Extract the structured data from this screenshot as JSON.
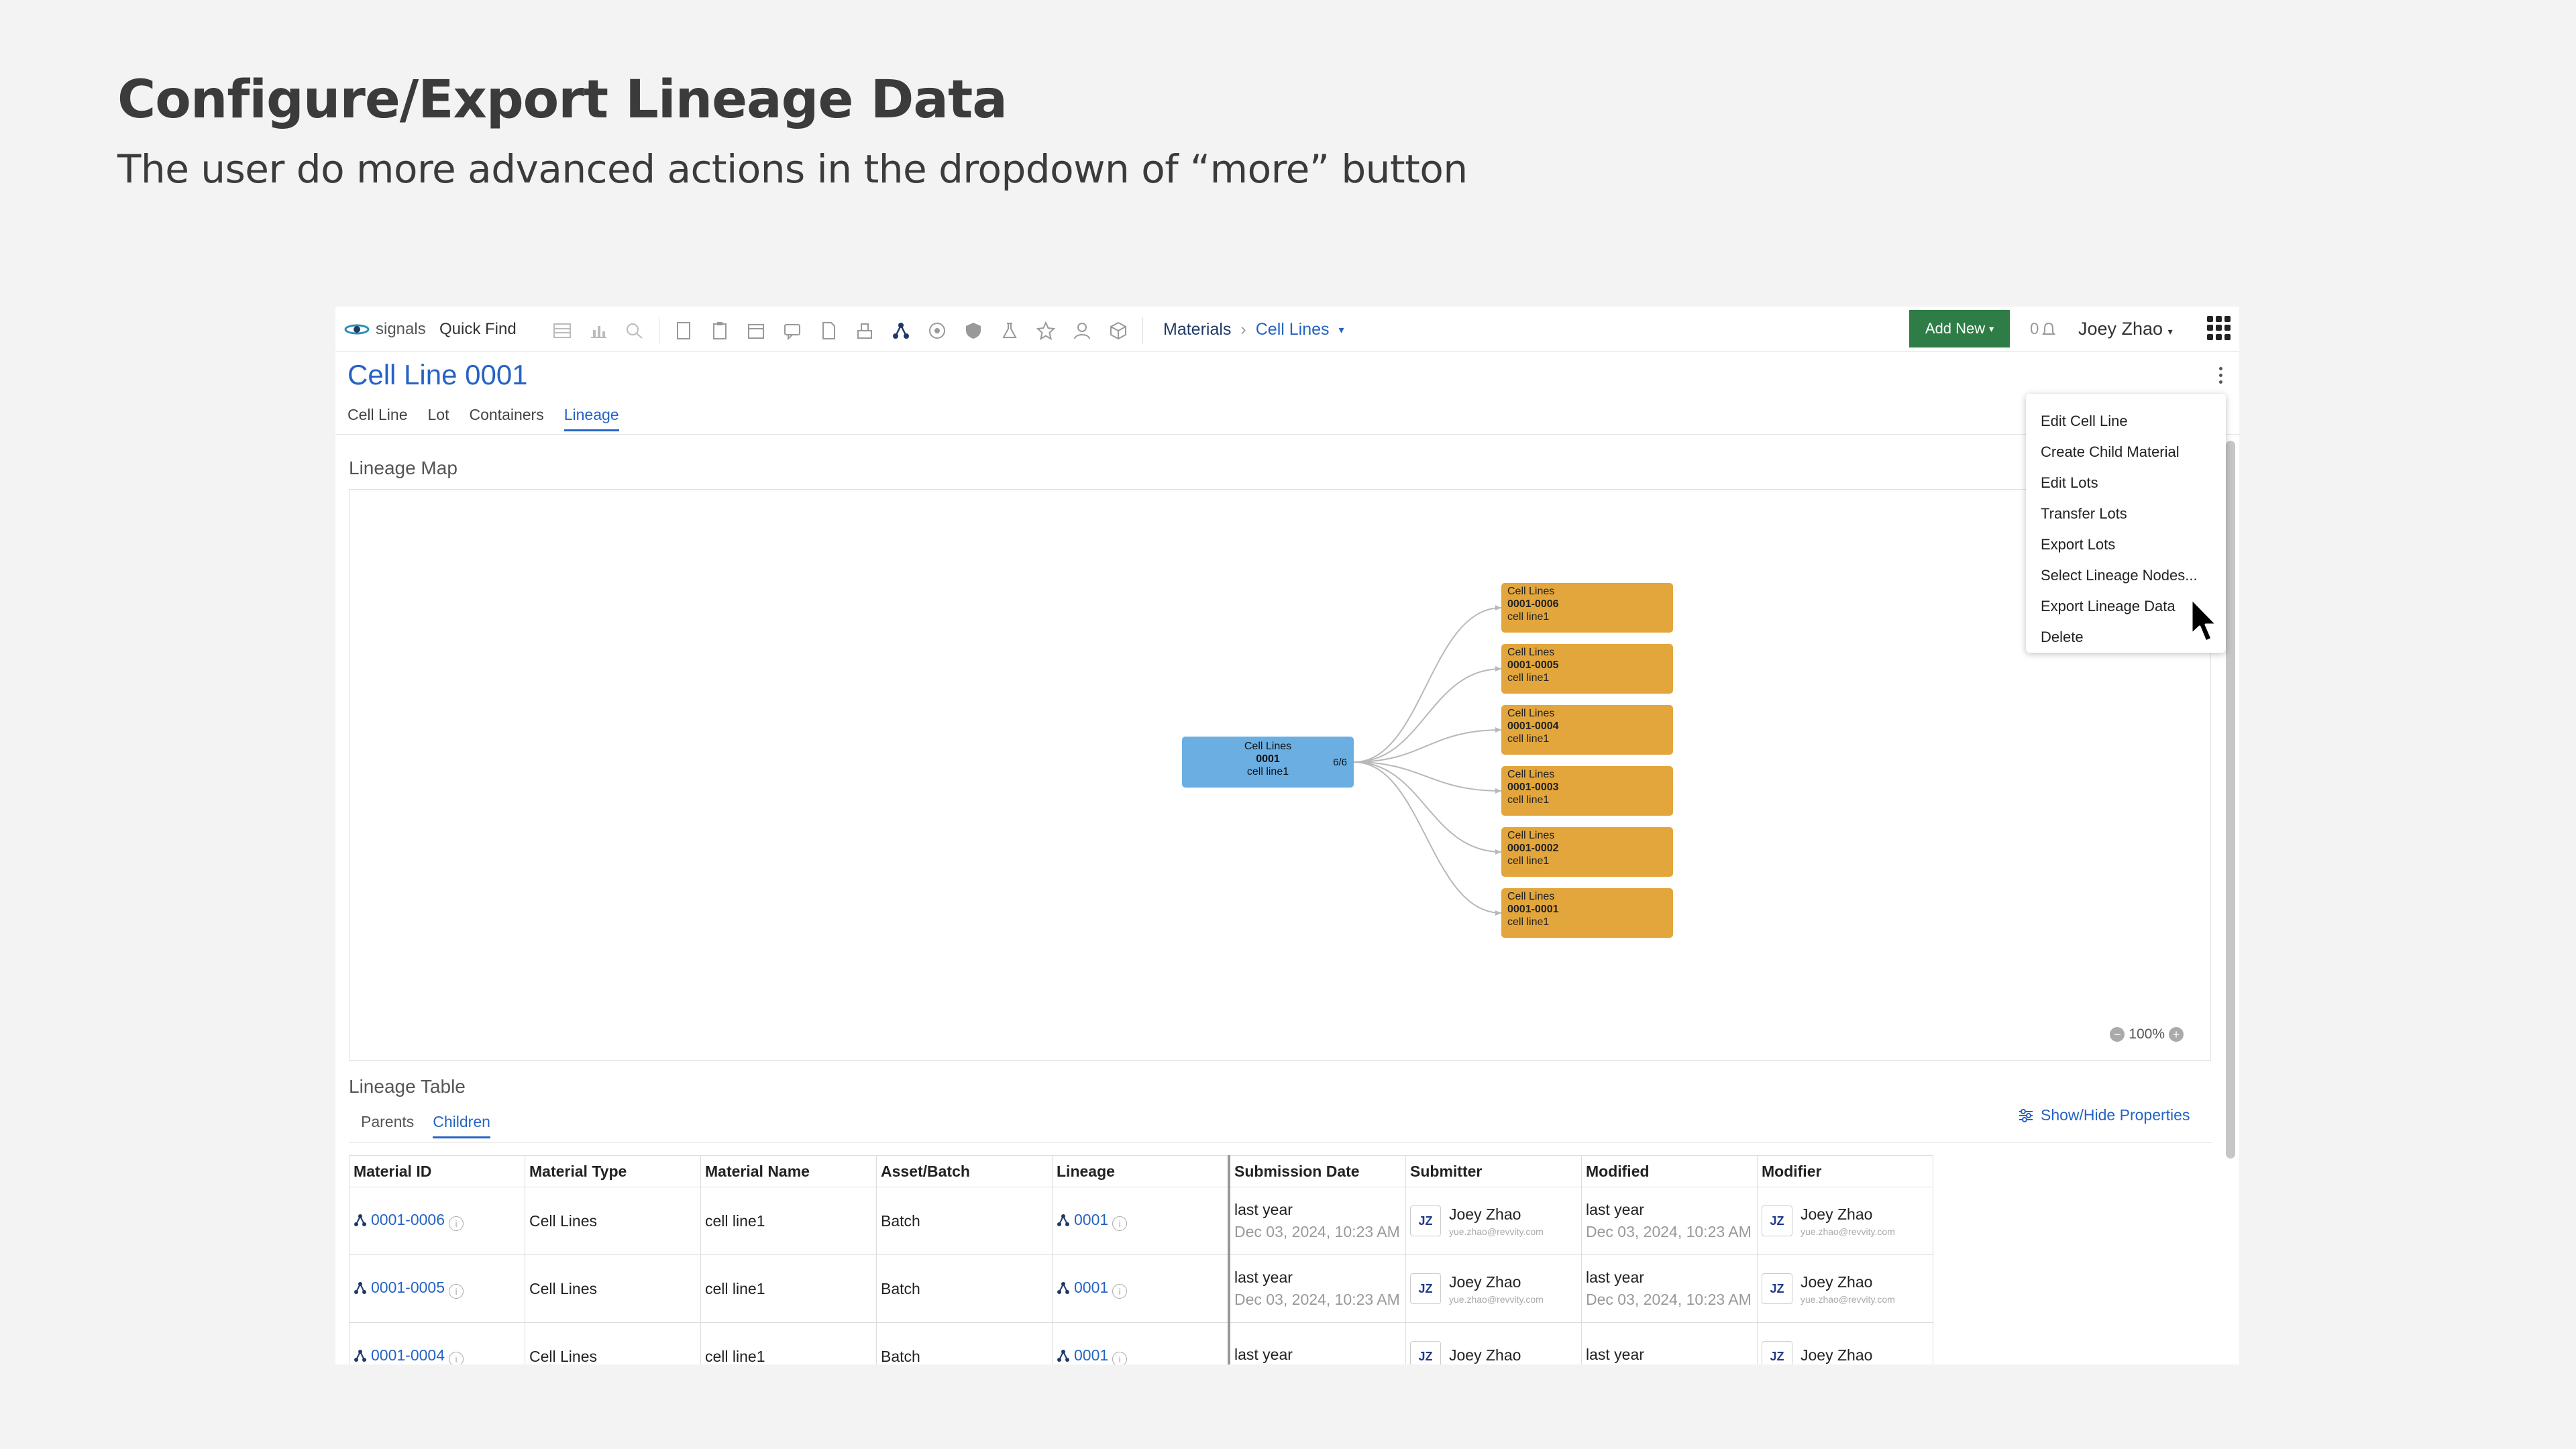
{
  "slide": {
    "title": "Configure/Export Lineage Data",
    "subtitle": "The user do more advanced actions in the dropdown of “more” button"
  },
  "topbar": {
    "logo_text": "signals",
    "quick_find": "Quick Find",
    "breadcrumb": [
      "Materials",
      "Cell Lines"
    ],
    "add_new": "Add New",
    "notification_count": "0",
    "user": "Joey Zhao"
  },
  "page": {
    "title": "Cell Line 0001",
    "tabs": [
      "Cell Line",
      "Lot",
      "Containers",
      "Lineage"
    ],
    "active_tab": "Lineage"
  },
  "more_menu": {
    "items": [
      "Edit Cell Line",
      "Create Child Material",
      "Edit Lots",
      "Transfer Lots",
      "Export Lots",
      "Select Lineage Nodes...",
      "Export Lineage Data",
      "Delete"
    ]
  },
  "lineage_map": {
    "label": "Lineage Map",
    "root": {
      "type": "Cell Lines",
      "id": "0001",
      "name": "cell line1",
      "ratio": "6/6"
    },
    "children": [
      {
        "type": "Cell Lines",
        "id": "0001-0006",
        "name": "cell line1"
      },
      {
        "type": "Cell Lines",
        "id": "0001-0005",
        "name": "cell line1"
      },
      {
        "type": "Cell Lines",
        "id": "0001-0004",
        "name": "cell line1"
      },
      {
        "type": "Cell Lines",
        "id": "0001-0003",
        "name": "cell line1"
      },
      {
        "type": "Cell Lines",
        "id": "0001-0002",
        "name": "cell line1"
      },
      {
        "type": "Cell Lines",
        "id": "0001-0001",
        "name": "cell line1"
      }
    ],
    "zoom": "100%"
  },
  "lineage_table": {
    "label": "Lineage Table",
    "subtabs": [
      "Parents",
      "Children"
    ],
    "active_subtab": "Children",
    "show_hide": "Show/Hide Properties",
    "columns": [
      "Material ID",
      "Material Type",
      "Material Name",
      "Asset/Batch",
      "Lineage",
      "Submission Date",
      "Submitter",
      "Modified",
      "Modifier"
    ],
    "rows": [
      {
        "id": "0001-0006",
        "type": "Cell Lines",
        "name": "cell line1",
        "asset": "Batch",
        "lineage": "0001",
        "sub_rel": "last year",
        "sub_date": "Dec 03, 2024, 10:23 AM",
        "submitter": "Joey Zhao",
        "submitter_email": "yue.zhao@revvity.com",
        "initials": "JZ",
        "mod_rel": "last year",
        "mod_date": "Dec 03, 2024, 10:23 AM",
        "modifier": "Joey Zhao",
        "modifier_email": "yue.zhao@revvity.com"
      },
      {
        "id": "0001-0005",
        "type": "Cell Lines",
        "name": "cell line1",
        "asset": "Batch",
        "lineage": "0001",
        "sub_rel": "last year",
        "sub_date": "Dec 03, 2024, 10:23 AM",
        "submitter": "Joey Zhao",
        "submitter_email": "yue.zhao@revvity.com",
        "initials": "JZ",
        "mod_rel": "last year",
        "mod_date": "Dec 03, 2024, 10:23 AM",
        "modifier": "Joey Zhao",
        "modifier_email": "yue.zhao@revvity.com"
      },
      {
        "id": "0001-0004",
        "type": "Cell Lines",
        "name": "cell line1",
        "asset": "Batch",
        "lineage": "0001",
        "sub_rel": "last year",
        "sub_date": "",
        "submitter": "Joey Zhao",
        "submitter_email": "",
        "initials": "JZ",
        "mod_rel": "last year",
        "mod_date": "",
        "modifier": "Joey Zhao",
        "modifier_email": ""
      }
    ]
  },
  "colors": {
    "accent": "#2563c4",
    "add_new": "#2e7d46",
    "root_node": "#6aaee2",
    "child_node": "#e3a63c"
  }
}
